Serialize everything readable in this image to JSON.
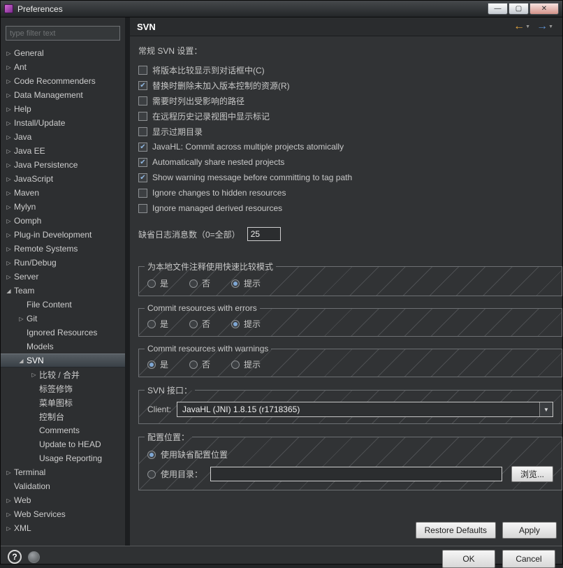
{
  "window": {
    "title": "Preferences",
    "buttons": [
      {
        "name": "minimize",
        "glyph": "—"
      },
      {
        "name": "maximize",
        "glyph": "▢"
      },
      {
        "name": "close",
        "glyph": "✕"
      }
    ]
  },
  "sidebar": {
    "filter_placeholder": "type filter text",
    "tree": [
      {
        "label": "General",
        "level": 0,
        "arrow": "collapsed"
      },
      {
        "label": "Ant",
        "level": 0,
        "arrow": "collapsed"
      },
      {
        "label": "Code Recommenders",
        "level": 0,
        "arrow": "collapsed"
      },
      {
        "label": "Data Management",
        "level": 0,
        "arrow": "collapsed"
      },
      {
        "label": "Help",
        "level": 0,
        "arrow": "collapsed"
      },
      {
        "label": "Install/Update",
        "level": 0,
        "arrow": "collapsed"
      },
      {
        "label": "Java",
        "level": 0,
        "arrow": "collapsed"
      },
      {
        "label": "Java EE",
        "level": 0,
        "arrow": "collapsed"
      },
      {
        "label": "Java Persistence",
        "level": 0,
        "arrow": "collapsed"
      },
      {
        "label": "JavaScript",
        "level": 0,
        "arrow": "collapsed"
      },
      {
        "label": "Maven",
        "level": 0,
        "arrow": "collapsed"
      },
      {
        "label": "Mylyn",
        "level": 0,
        "arrow": "collapsed"
      },
      {
        "label": "Oomph",
        "level": 0,
        "arrow": "collapsed"
      },
      {
        "label": "Plug-in Development",
        "level": 0,
        "arrow": "collapsed"
      },
      {
        "label": "Remote Systems",
        "level": 0,
        "arrow": "collapsed"
      },
      {
        "label": "Run/Debug",
        "level": 0,
        "arrow": "collapsed"
      },
      {
        "label": "Server",
        "level": 0,
        "arrow": "collapsed"
      },
      {
        "label": "Team",
        "level": 0,
        "arrow": "expanded"
      },
      {
        "label": "File Content",
        "level": 1,
        "arrow": "none"
      },
      {
        "label": "Git",
        "level": 1,
        "arrow": "collapsed"
      },
      {
        "label": "Ignored Resources",
        "level": 1,
        "arrow": "none"
      },
      {
        "label": "Models",
        "level": 1,
        "arrow": "none"
      },
      {
        "label": "SVN",
        "level": 1,
        "arrow": "expanded",
        "selected": true
      },
      {
        "label": "比较 / 合并",
        "level": 2,
        "arrow": "collapsed"
      },
      {
        "label": "标签修饰",
        "level": 2,
        "arrow": "none"
      },
      {
        "label": "菜单图标",
        "level": 2,
        "arrow": "none"
      },
      {
        "label": "控制台",
        "level": 2,
        "arrow": "none"
      },
      {
        "label": "Comments",
        "level": 2,
        "arrow": "none"
      },
      {
        "label": "Update to HEAD",
        "level": 2,
        "arrow": "none"
      },
      {
        "label": "Usage Reporting",
        "level": 2,
        "arrow": "none"
      },
      {
        "label": "Terminal",
        "level": 0,
        "arrow": "collapsed"
      },
      {
        "label": "Validation",
        "level": 0,
        "arrow": "none"
      },
      {
        "label": "Web",
        "level": 0,
        "arrow": "collapsed"
      },
      {
        "label": "Web Services",
        "level": 0,
        "arrow": "collapsed"
      },
      {
        "label": "XML",
        "level": 0,
        "arrow": "collapsed"
      }
    ]
  },
  "header": {
    "title": "SVN"
  },
  "content": {
    "section_title": "常规 SVN 设置：",
    "checkboxes": [
      {
        "label": "将版本比较显示到对话框中(C)",
        "checked": false
      },
      {
        "label": "替换时删除未加入版本控制的资源(R)",
        "checked": true
      },
      {
        "label": "需要时列出受影响的路径",
        "checked": false
      },
      {
        "label": "在远程历史记录视图中显示标记",
        "checked": false
      },
      {
        "label": "显示过期目录",
        "checked": false
      },
      {
        "label": "JavaHL: Commit across multiple projects atomically",
        "checked": true
      },
      {
        "label": "Automatically share nested projects",
        "checked": true
      },
      {
        "label": "Show warning message before committing to tag path",
        "checked": true
      },
      {
        "label": "Ignore changes to hidden resources",
        "checked": false
      },
      {
        "label": "Ignore managed derived resources",
        "checked": false
      }
    ],
    "log_count": {
      "label": "缺省日志消息数（0=全部）",
      "value": "25"
    },
    "radio_groups": [
      {
        "title": "为本地文件注释使用快速比较模式",
        "options": [
          "是",
          "否",
          "提示"
        ],
        "selected": 2
      },
      {
        "title": "Commit resources with errors",
        "options": [
          "是",
          "否",
          "提示"
        ],
        "selected": 2
      },
      {
        "title": "Commit resources with warnings",
        "options": [
          "是",
          "否",
          "提示"
        ],
        "selected": 0
      }
    ],
    "svn_interface": {
      "title": "SVN 接口：",
      "client_label": "Client:",
      "client_value": "JavaHL (JNI) 1.8.15 (r1718365)"
    },
    "config_location": {
      "title": "配置位置：",
      "use_default_label": "使用缺省配置位置",
      "use_default_selected": true,
      "use_dir_label": "使用目录：",
      "dir_value": "",
      "browse_label": "浏览..."
    },
    "buttons": {
      "restore_defaults": "Restore Defaults",
      "apply": "Apply"
    }
  },
  "footer": {
    "ok": "OK",
    "cancel": "Cancel"
  },
  "colors": {
    "accent_blue": "#7fa7d4",
    "back_arrow": "#e4a63d",
    "forward_arrow": "#5e90d1"
  }
}
